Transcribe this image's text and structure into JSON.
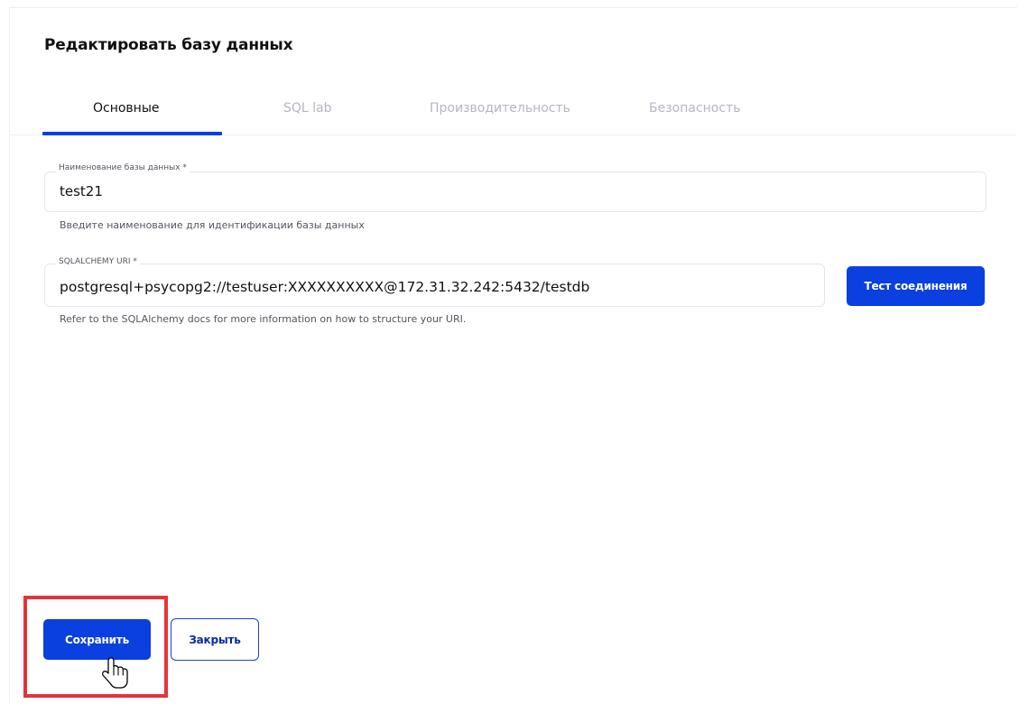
{
  "modal": {
    "title": "Редактировать базу данных"
  },
  "tabs": [
    {
      "label": "Основные",
      "active": true
    },
    {
      "label": "SQL lab",
      "active": false
    },
    {
      "label": "Производительность",
      "active": false
    },
    {
      "label": "Безопасность",
      "active": false
    }
  ],
  "db_name_field": {
    "label": "Наименование базы данных *",
    "value": "test21",
    "helper": "Введите наименование для идентификации базы данных"
  },
  "uri_field": {
    "label": "SQLALCHEMY URI *",
    "value": "postgresql+psycopg2://testuser:XXXXXXXXXX@172.31.32.242:5432/testdb",
    "helper": "Refer to the SQLAlchemy docs for more information on how to structure your URI.",
    "test_button": "Тест соединения"
  },
  "footer": {
    "save_button": "Сохранить",
    "close_button": "Закрыть"
  },
  "colors": {
    "accent": "#0a3fe0",
    "highlight": "#e4343a",
    "inactive_tab": "#b6b6c2"
  },
  "icons": {
    "cursor": "hand-pointer-icon"
  }
}
